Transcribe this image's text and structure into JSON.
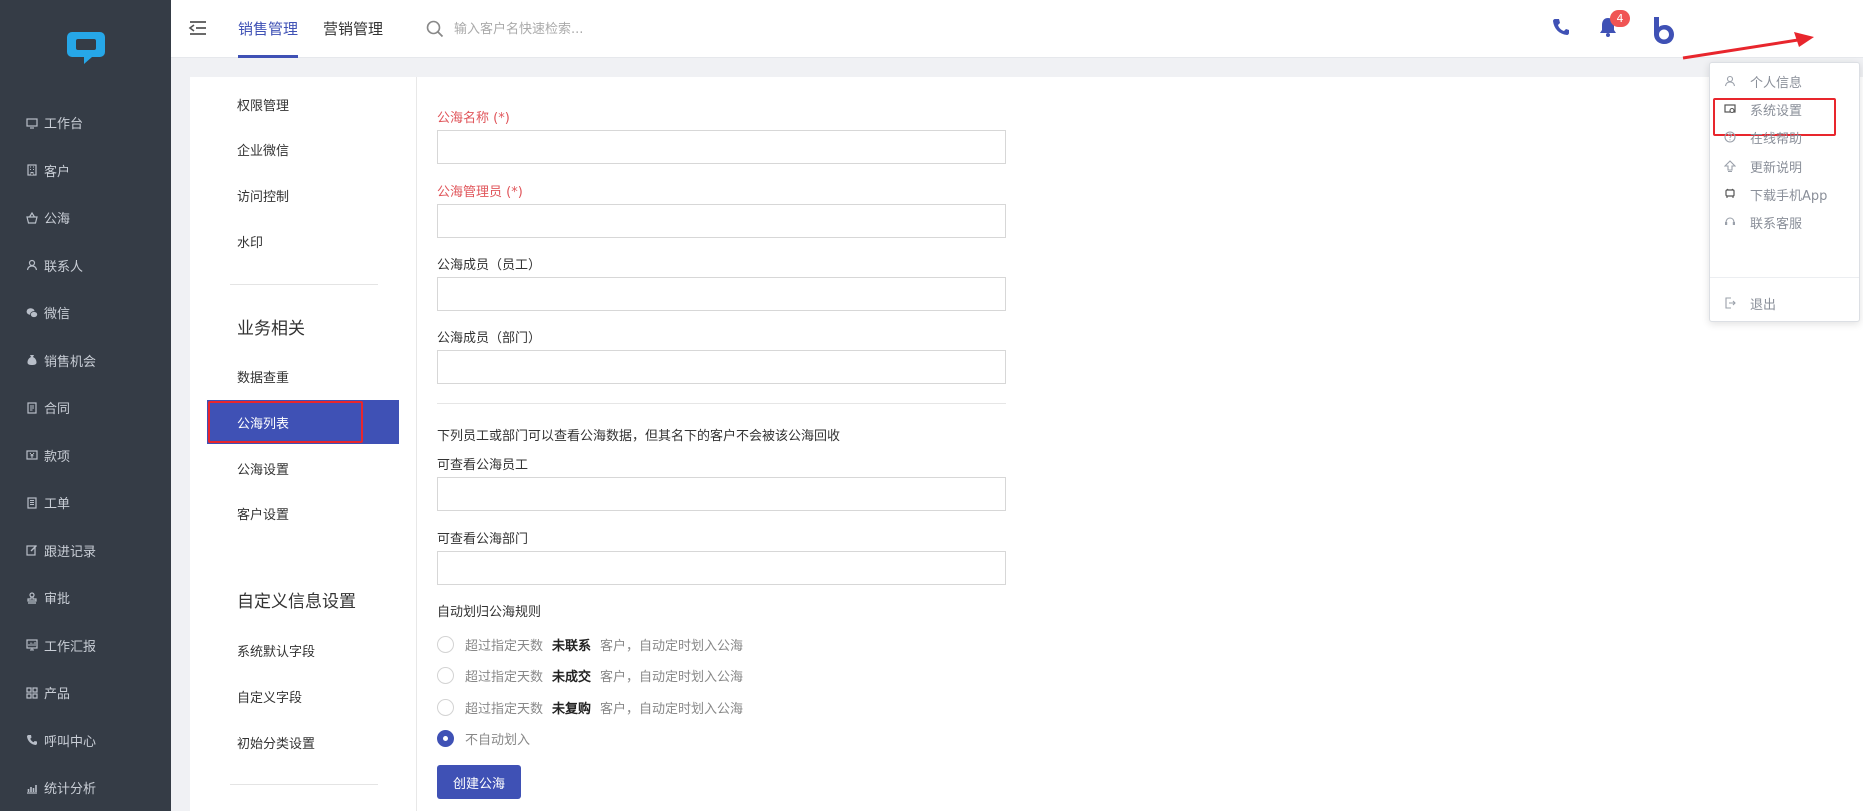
{
  "sidebar": {
    "items": [
      {
        "label": "工作台",
        "icon": "monitor-icon"
      },
      {
        "label": "客户",
        "icon": "building-icon"
      },
      {
        "label": "公海",
        "icon": "basket-icon"
      },
      {
        "label": "联系人",
        "icon": "user-icon"
      },
      {
        "label": "微信",
        "icon": "wechat-icon"
      },
      {
        "label": "销售机会",
        "icon": "money-bag-icon"
      },
      {
        "label": "合同",
        "icon": "contract-icon"
      },
      {
        "label": "款项",
        "icon": "payment-icon"
      },
      {
        "label": "工单",
        "icon": "ticket-icon"
      },
      {
        "label": "跟进记录",
        "icon": "edit-icon"
      },
      {
        "label": "审批",
        "icon": "stamp-icon"
      },
      {
        "label": "工作汇报",
        "icon": "report-icon"
      },
      {
        "label": "产品",
        "icon": "grid-icon"
      },
      {
        "label": "呼叫中心",
        "icon": "phone-icon"
      },
      {
        "label": "统计分析",
        "icon": "chart-icon"
      }
    ]
  },
  "header": {
    "tabs": [
      {
        "label": "销售管理",
        "active": true
      },
      {
        "label": "营销管理",
        "active": false
      }
    ],
    "search_placeholder": "输入客户名快速检索...",
    "notification_count": "4",
    "accent_color": "#3f51b5"
  },
  "subnav": {
    "top_items": [
      "权限管理",
      "企业微信",
      "访问控制",
      "水印"
    ],
    "business_title": "业务相关",
    "business_items": [
      "数据查重",
      "公海列表",
      "公海设置",
      "客户设置"
    ],
    "active_item": "公海列表",
    "custom_title": "自定义信息设置",
    "custom_items": [
      "系统默认字段",
      "自定义字段",
      "初始分类设置"
    ]
  },
  "form": {
    "name_label": "公海名称 (*)",
    "admin_label": "公海管理员 (*)",
    "members_staff_label": "公海成员（员工）",
    "members_dept_label": "公海成员（部门）",
    "note": "下列员工或部门可以查看公海数据，但其名下的客户不会被该公海回收",
    "view_staff_label": "可查看公海员工",
    "view_dept_label": "可查看公海部门",
    "rule_title": "自动划归公海规则",
    "rules": [
      {
        "prefix": "超过指定天数",
        "keyword": "未联系",
        "suffix": "客户，自动定时划入公海",
        "checked": false
      },
      {
        "prefix": "超过指定天数",
        "keyword": "未成交",
        "suffix": "客户，自动定时划入公海",
        "checked": false
      },
      {
        "prefix": "超过指定天数",
        "keyword": "未复购",
        "suffix": "客户，自动定时划入公海",
        "checked": false
      },
      {
        "prefix": "不自动划入",
        "keyword": "",
        "suffix": "",
        "checked": true
      }
    ],
    "create_button": "创建公海"
  },
  "user_menu": {
    "items": [
      {
        "label": "个人信息",
        "icon": "person-icon"
      },
      {
        "label": "系统设置",
        "icon": "settings-icon"
      },
      {
        "label": "在线帮助",
        "icon": "help-icon"
      },
      {
        "label": "更新说明",
        "icon": "upgrade-icon"
      },
      {
        "label": "下载手机App",
        "icon": "mobile-icon"
      },
      {
        "label": "联系客服",
        "icon": "headset-icon"
      }
    ],
    "logout": {
      "label": "退出",
      "icon": "logout-icon"
    }
  }
}
